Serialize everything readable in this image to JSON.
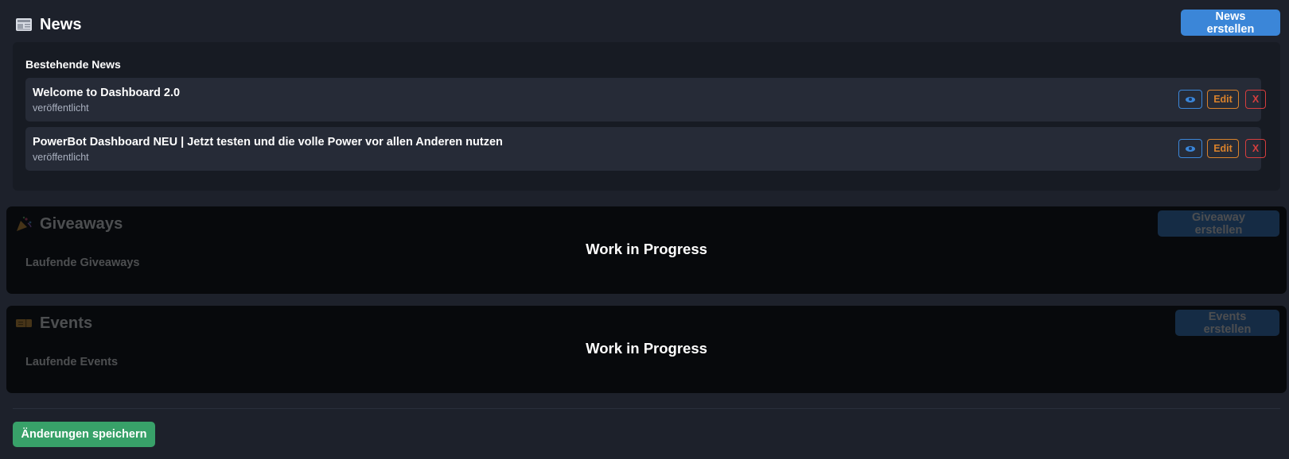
{
  "news": {
    "title": "News",
    "icon": "newspaper-icon",
    "create_label": "News erstellen",
    "heading": "Bestehende News",
    "items": [
      {
        "title": "Welcome to Dashboard 2.0",
        "status": "veröffentlicht",
        "edit_label": "Edit",
        "delete_label": "X"
      },
      {
        "title": "PowerBot Dashboard NEU | Jetzt testen und die volle Power vor allen Anderen nutzen",
        "status": "veröffentlicht",
        "edit_label": "Edit",
        "delete_label": "X"
      }
    ]
  },
  "giveaways": {
    "title": "Giveaways",
    "icon": "party-popper-icon",
    "create_label": "Giveaway erstellen",
    "subheading": "Laufende Giveaways",
    "wip_label": "Work in Progress"
  },
  "events": {
    "title": "Events",
    "icon": "ticket-icon",
    "create_label": "Events erstellen",
    "subheading": "Laufende Events",
    "wip_label": "Work in Progress"
  },
  "footer": {
    "save_label": "Änderungen speichern"
  },
  "colors": {
    "background": "#1d212b",
    "primary": "#3b86d8",
    "edit": "#d9822b",
    "danger": "#d63e3e",
    "success": "#38a169"
  }
}
